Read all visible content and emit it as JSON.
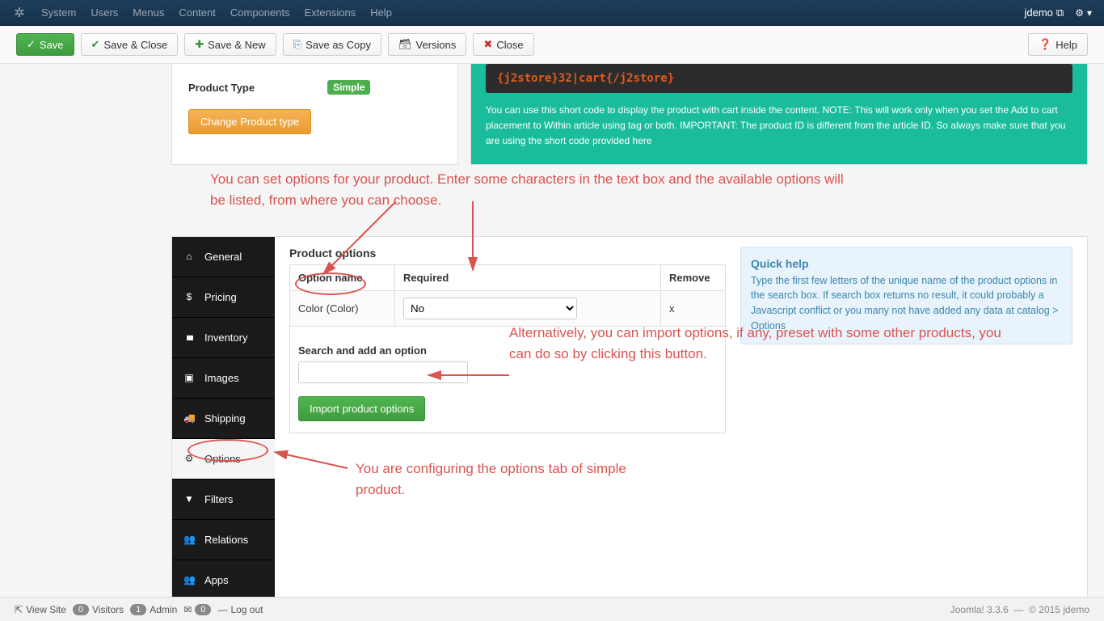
{
  "navbar": {
    "menu": [
      "System",
      "Users",
      "Menus",
      "Content",
      "Components",
      "Extensions",
      "Help"
    ],
    "user": "jdemo"
  },
  "toolbar": {
    "save": "Save",
    "save_close": "Save & Close",
    "save_new": "Save & New",
    "save_copy": "Save as Copy",
    "versions": "Versions",
    "close": "Close",
    "help": "Help"
  },
  "product": {
    "type_label": "Product Type",
    "type_value": "Simple",
    "change_btn": "Change Product type"
  },
  "shortcode": {
    "code": "{j2store}32|cart{/j2store}",
    "help": "You can use this short code to display the product with cart inside the content. NOTE: This will work only when you set the Add to cart placement to Within article using tag or both. IMPORTANT: The product ID is different from the article ID. So always make sure that you are using the short code provided here"
  },
  "annotations": {
    "a1": "You can set options for your product. Enter some characters in the text box and the available options will be listed, from where you can choose.",
    "a2": "Alternatively, you can import options, if any, preset with some other products, you can do so by clicking this button.",
    "a3": "You are configuring the options tab of simple product."
  },
  "sidebar": {
    "items": [
      {
        "icon": "⌂",
        "label": "General"
      },
      {
        "icon": "$",
        "label": "Pricing"
      },
      {
        "icon": "▮▮▮",
        "label": "Inventory"
      },
      {
        "icon": "▣",
        "label": "Images"
      },
      {
        "icon": "🚚",
        "label": "Shipping"
      },
      {
        "icon": "⚙",
        "label": "Options"
      },
      {
        "icon": "▼",
        "label": "Filters"
      },
      {
        "icon": "👥",
        "label": "Relations"
      },
      {
        "icon": "👥",
        "label": "Apps"
      }
    ],
    "active": 5
  },
  "options": {
    "title": "Product options",
    "headers": {
      "name": "Option name",
      "required": "Required",
      "remove": "Remove"
    },
    "rows": [
      {
        "name": "Color (Color)",
        "required": "No",
        "remove": "x"
      }
    ],
    "search_label": "Search and add an option",
    "import_btn": "Import product options"
  },
  "quickhelp": {
    "title": "Quick help",
    "text": "Type the first few letters of the unique name of the product options in the search box. If search box returns no result, it could probably a Javascript conflict or you many not have added any data at catalog > Options"
  },
  "statusbar": {
    "view_site": "View Site",
    "visitors": "Visitors",
    "visitors_count": "0",
    "admin": "Admin",
    "admin_count": "1",
    "messages_count": "0",
    "logout": "Log out",
    "version": "Joomla! 3.3.6",
    "copyright": "© 2015 jdemo"
  }
}
